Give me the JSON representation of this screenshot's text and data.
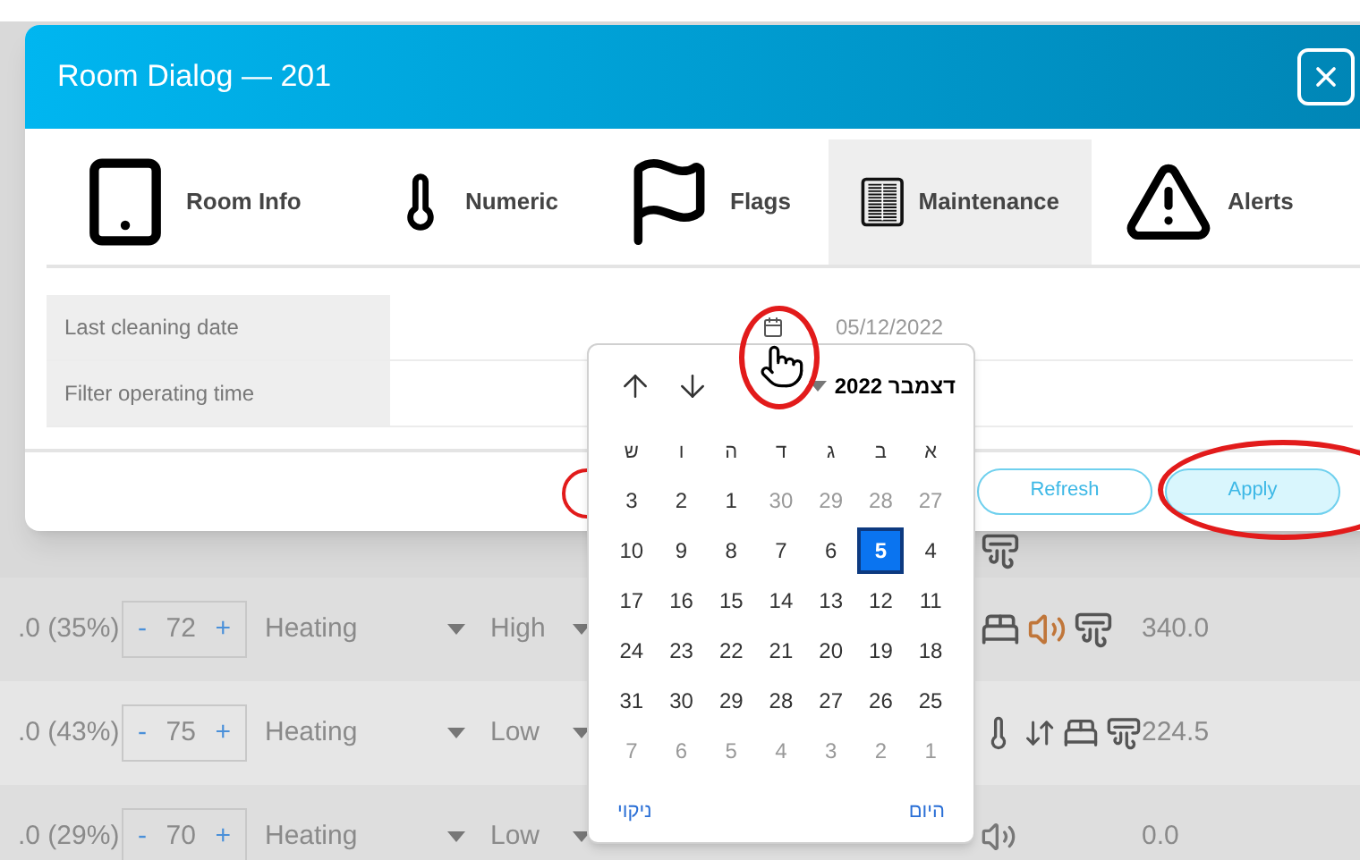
{
  "dialog": {
    "title": "Room Dialog — 201",
    "tabs": [
      {
        "label": "Room Info",
        "selected": false
      },
      {
        "label": "Numeric",
        "selected": false
      },
      {
        "label": "Flags",
        "selected": false
      },
      {
        "label": "Maintenance",
        "selected": true
      },
      {
        "label": "Alerts",
        "selected": false
      }
    ],
    "fields": [
      {
        "label": "Last cleaning date",
        "value": "05/12/2022"
      },
      {
        "label": "Filter operating time"
      }
    ],
    "buttons": [
      {
        "label": "Refresh",
        "kind": "outline"
      },
      {
        "label": "Apply",
        "kind": "filled"
      }
    ]
  },
  "calendar": {
    "month": "דצמבר 2022",
    "weekdays": [
      "א",
      "ב",
      "ג",
      "ד",
      "ה",
      "ו",
      "ש"
    ],
    "days": [
      {
        "label": "3",
        "muted": false,
        "selected": false
      },
      {
        "label": "2",
        "muted": false,
        "selected": false
      },
      {
        "label": "1",
        "muted": false,
        "selected": false
      },
      {
        "label": "30",
        "muted": true,
        "selected": false
      },
      {
        "label": "29",
        "muted": true,
        "selected": false
      },
      {
        "label": "28",
        "muted": true,
        "selected": false
      },
      {
        "label": "27",
        "muted": true,
        "selected": false
      },
      {
        "label": "10",
        "muted": false,
        "selected": false
      },
      {
        "label": "9",
        "muted": false,
        "selected": false
      },
      {
        "label": "8",
        "muted": false,
        "selected": false
      },
      {
        "label": "7",
        "muted": false,
        "selected": false
      },
      {
        "label": "6",
        "muted": false,
        "selected": false
      },
      {
        "label": "5",
        "muted": false,
        "selected": true
      },
      {
        "label": "4",
        "muted": false,
        "selected": false
      },
      {
        "label": "17",
        "muted": false,
        "selected": false
      },
      {
        "label": "16",
        "muted": false,
        "selected": false
      },
      {
        "label": "15",
        "muted": false,
        "selected": false
      },
      {
        "label": "14",
        "muted": false,
        "selected": false
      },
      {
        "label": "13",
        "muted": false,
        "selected": false
      },
      {
        "label": "12",
        "muted": false,
        "selected": false
      },
      {
        "label": "11",
        "muted": false,
        "selected": false
      },
      {
        "label": "24",
        "muted": false,
        "selected": false
      },
      {
        "label": "23",
        "muted": false,
        "selected": false
      },
      {
        "label": "22",
        "muted": false,
        "selected": false
      },
      {
        "label": "21",
        "muted": false,
        "selected": false
      },
      {
        "label": "20",
        "muted": false,
        "selected": false
      },
      {
        "label": "19",
        "muted": false,
        "selected": false
      },
      {
        "label": "18",
        "muted": false,
        "selected": false
      },
      {
        "label": "31",
        "muted": false,
        "selected": false
      },
      {
        "label": "30",
        "muted": false,
        "selected": false
      },
      {
        "label": "29",
        "muted": false,
        "selected": false
      },
      {
        "label": "28",
        "muted": false,
        "selected": false
      },
      {
        "label": "27",
        "muted": false,
        "selected": false
      },
      {
        "label": "26",
        "muted": false,
        "selected": false
      },
      {
        "label": "25",
        "muted": false,
        "selected": false
      },
      {
        "label": "7",
        "muted": true,
        "selected": false
      },
      {
        "label": "6",
        "muted": true,
        "selected": false
      },
      {
        "label": "5",
        "muted": true,
        "selected": false
      },
      {
        "label": "4",
        "muted": true,
        "selected": false
      },
      {
        "label": "3",
        "muted": true,
        "selected": false
      },
      {
        "label": "2",
        "muted": true,
        "selected": false
      },
      {
        "label": "1",
        "muted": true,
        "selected": false
      }
    ],
    "today": "היום",
    "clear": "ניקוי"
  },
  "rows": [
    {
      "column_1": ".0 (35%)",
      "dec": "-",
      "setpoint": "72",
      "inc": "+",
      "mode": "Heating",
      "fan": "High",
      "value": "340.0"
    },
    {
      "column_1": ".0 (43%)",
      "dec": "-",
      "setpoint": "75",
      "inc": "+",
      "mode": "Heating",
      "fan": "Low",
      "value": "224.5"
    },
    {
      "column_1": ".0 (29%)",
      "dec": "-",
      "setpoint": "70",
      "inc": "+",
      "mode": "Heating",
      "fan": "Low",
      "value": "0.0"
    }
  ]
}
